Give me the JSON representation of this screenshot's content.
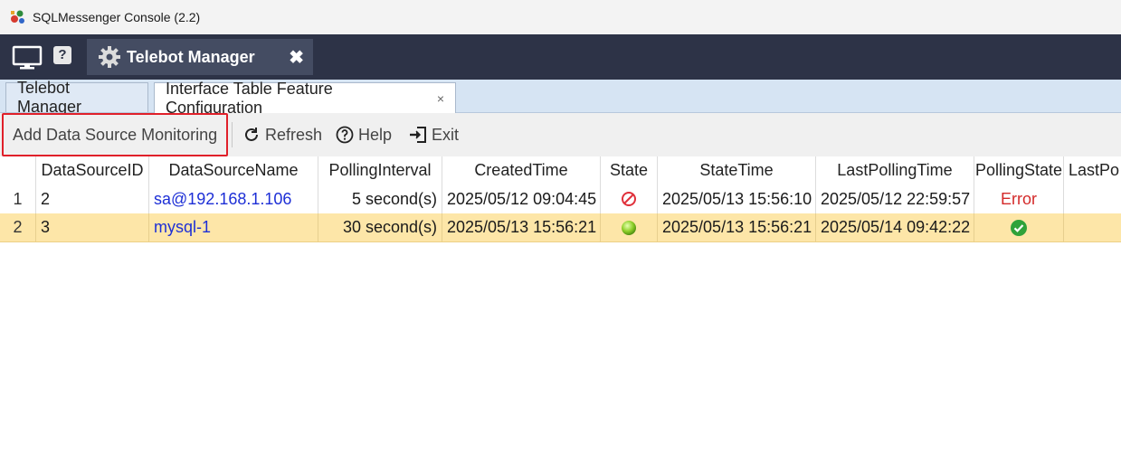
{
  "window": {
    "title": "SQLMessenger Console (2.2)"
  },
  "header": {
    "main_tab_label": "Telebot Manager",
    "main_tab_close": "✖",
    "help_icon_text": "?"
  },
  "subtabs": [
    {
      "label": "Telebot Manager"
    },
    {
      "label": "Interface Table Feature Configuration",
      "close": "×"
    }
  ],
  "toolbar": {
    "add_label": "Add Data Source Monitoring",
    "refresh_label": "Refresh",
    "help_label": "Help",
    "exit_label": "Exit"
  },
  "table": {
    "columns": [
      "DataSourceID",
      "DataSourceName",
      "PollingInterval",
      "CreatedTime",
      "State",
      "StateTime",
      "LastPollingTime",
      "PollingState",
      "LastPo"
    ],
    "rows": [
      {
        "num": "1",
        "id": "2",
        "name": "sa@192.168.1.106",
        "interval": "5 second(s)",
        "created": "2025/05/12 09:04:45",
        "state_icon": "blocked-icon",
        "state_time": "2025/05/13 15:56:10",
        "last_polling": "2025/05/12 22:59:57",
        "polling_state": "Error"
      },
      {
        "num": "2",
        "id": "3",
        "name": "mysql-1",
        "interval": "30 second(s)",
        "created": "2025/05/13 15:56:21",
        "state_icon": "green-dot-icon",
        "state_time": "2025/05/13 15:56:21",
        "last_polling": "2025/05/14 09:42:22",
        "polling_state_icon": "check-circle-icon"
      }
    ]
  },
  "colors": {
    "header_dark": "#2d3347",
    "selected_row": "#fde6a8",
    "link": "#1d2fd6",
    "error": "#d42a2a",
    "highlight_border": "#e0202a"
  }
}
